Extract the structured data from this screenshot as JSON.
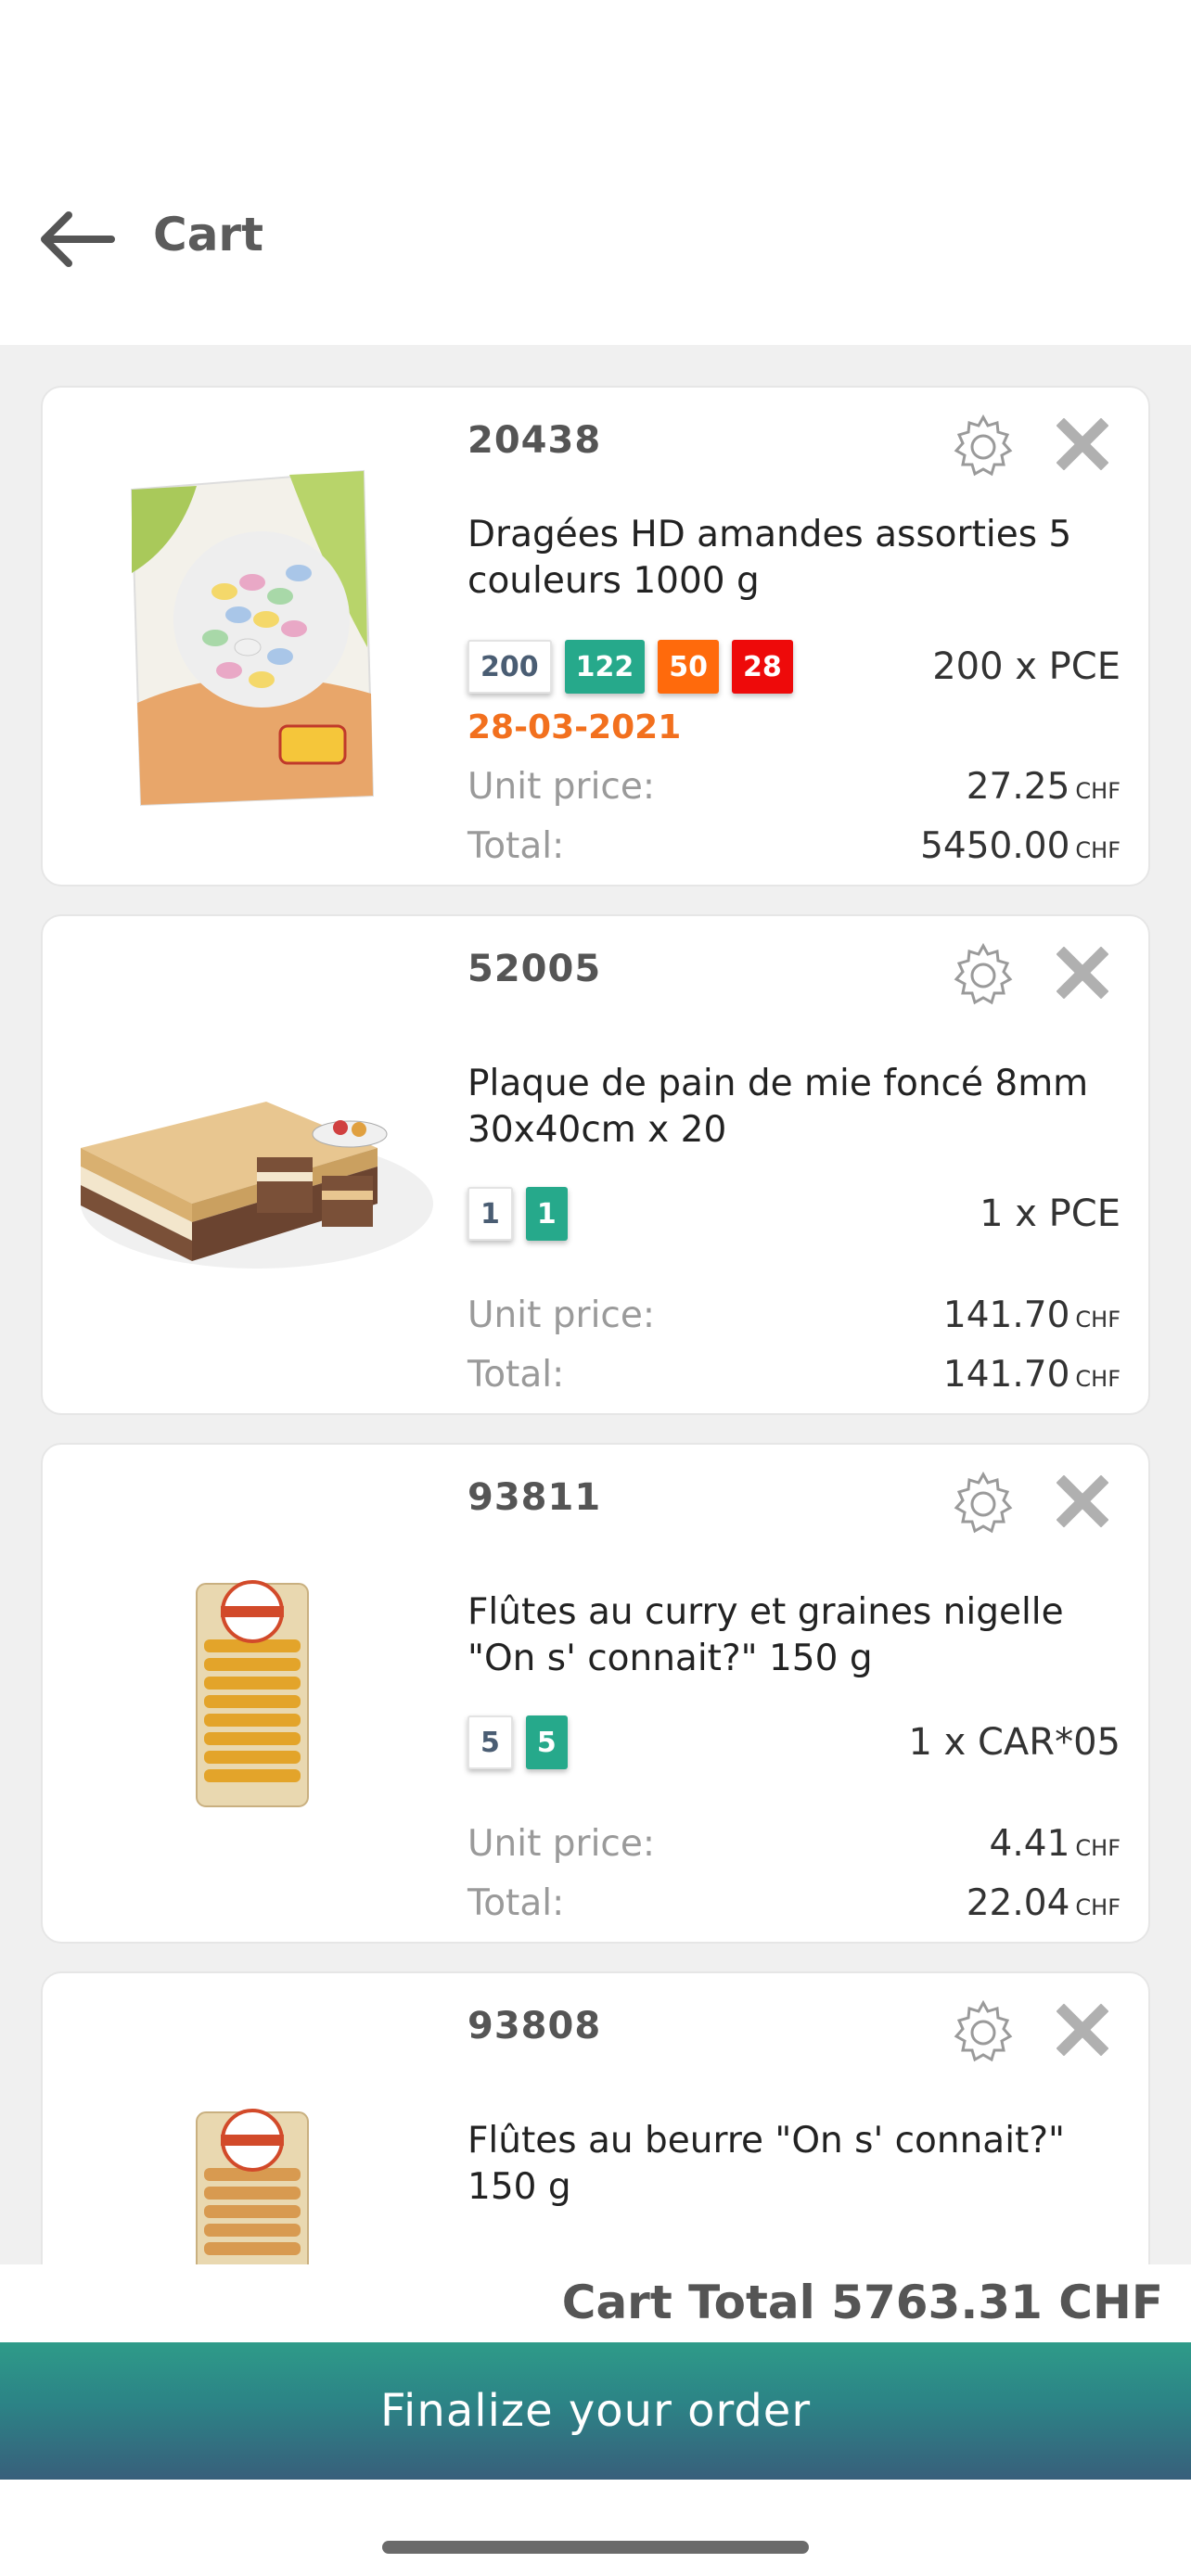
{
  "header": {
    "title": "Cart",
    "back_icon": "arrow-left-icon"
  },
  "colors": {
    "teal": "#26a98b",
    "orange": "#ff6a0c",
    "red": "#ee0a0a",
    "date": "#f2701e",
    "button_gradient": [
      "#2e9b89",
      "#385f7b"
    ]
  },
  "labels": {
    "unit_price": "Unit price:",
    "total": "Total:",
    "currency": "CHF"
  },
  "items": [
    {
      "code": "20438",
      "name": "Dragées HD amandes assorties 5 couleurs 1000 g",
      "badges": [
        {
          "text": "200",
          "style": "white"
        },
        {
          "text": "122",
          "style": "teal"
        },
        {
          "text": "50",
          "style": "orange"
        },
        {
          "text": "28",
          "style": "red"
        }
      ],
      "quantity": "200 x PCE",
      "date": "28-03-2021",
      "unit_price": "27.25",
      "total": "5450.00"
    },
    {
      "code": "52005",
      "name": "Plaque de pain de mie foncé 8mm 30x40cm x 20",
      "badges": [
        {
          "text": "1",
          "style": "white"
        },
        {
          "text": "1",
          "style": "teal"
        }
      ],
      "quantity": "1 x PCE",
      "unit_price": "141.70",
      "total": "141.70"
    },
    {
      "code": "93811",
      "name": "Flûtes au curry et graines nigelle \"On s' connait?\" 150 g",
      "badges": [
        {
          "text": "5",
          "style": "white"
        },
        {
          "text": "5",
          "style": "teal"
        }
      ],
      "quantity": "1 x CAR*05",
      "unit_price": "4.41",
      "total": "22.04"
    },
    {
      "code": "93808",
      "name": "Flûtes au beurre \"On s' connait?\" 150 g"
    }
  ],
  "footer": {
    "cart_total": "Cart Total 5763.31 CHF",
    "finalize_label": "Finalize your order"
  }
}
